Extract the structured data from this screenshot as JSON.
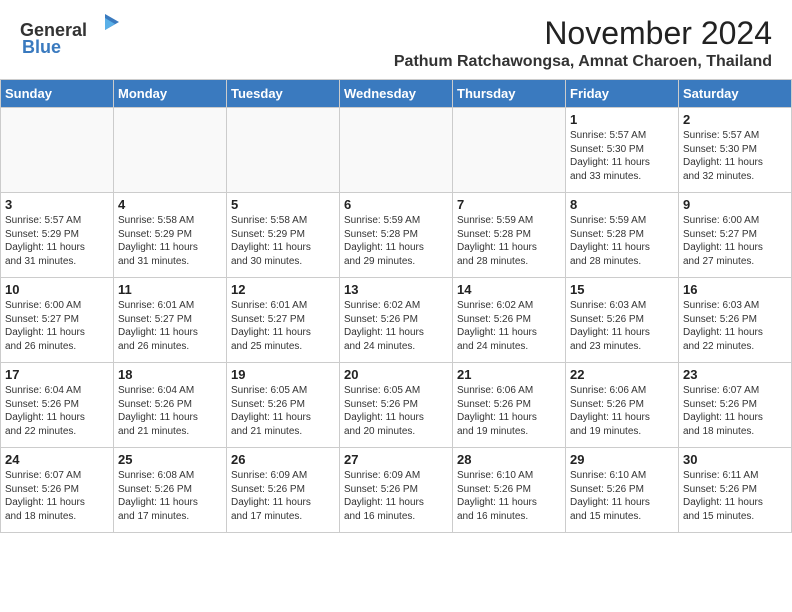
{
  "logo": {
    "general": "General",
    "blue": "Blue"
  },
  "title": "November 2024",
  "location": "Pathum Ratchawongsa, Amnat Charoen, Thailand",
  "weekdays": [
    "Sunday",
    "Monday",
    "Tuesday",
    "Wednesday",
    "Thursday",
    "Friday",
    "Saturday"
  ],
  "weeks": [
    [
      {
        "day": "",
        "info": ""
      },
      {
        "day": "",
        "info": ""
      },
      {
        "day": "",
        "info": ""
      },
      {
        "day": "",
        "info": ""
      },
      {
        "day": "",
        "info": ""
      },
      {
        "day": "1",
        "info": "Sunrise: 5:57 AM\nSunset: 5:30 PM\nDaylight: 11 hours\nand 33 minutes."
      },
      {
        "day": "2",
        "info": "Sunrise: 5:57 AM\nSunset: 5:30 PM\nDaylight: 11 hours\nand 32 minutes."
      }
    ],
    [
      {
        "day": "3",
        "info": "Sunrise: 5:57 AM\nSunset: 5:29 PM\nDaylight: 11 hours\nand 31 minutes."
      },
      {
        "day": "4",
        "info": "Sunrise: 5:58 AM\nSunset: 5:29 PM\nDaylight: 11 hours\nand 31 minutes."
      },
      {
        "day": "5",
        "info": "Sunrise: 5:58 AM\nSunset: 5:29 PM\nDaylight: 11 hours\nand 30 minutes."
      },
      {
        "day": "6",
        "info": "Sunrise: 5:59 AM\nSunset: 5:28 PM\nDaylight: 11 hours\nand 29 minutes."
      },
      {
        "day": "7",
        "info": "Sunrise: 5:59 AM\nSunset: 5:28 PM\nDaylight: 11 hours\nand 28 minutes."
      },
      {
        "day": "8",
        "info": "Sunrise: 5:59 AM\nSunset: 5:28 PM\nDaylight: 11 hours\nand 28 minutes."
      },
      {
        "day": "9",
        "info": "Sunrise: 6:00 AM\nSunset: 5:27 PM\nDaylight: 11 hours\nand 27 minutes."
      }
    ],
    [
      {
        "day": "10",
        "info": "Sunrise: 6:00 AM\nSunset: 5:27 PM\nDaylight: 11 hours\nand 26 minutes."
      },
      {
        "day": "11",
        "info": "Sunrise: 6:01 AM\nSunset: 5:27 PM\nDaylight: 11 hours\nand 26 minutes."
      },
      {
        "day": "12",
        "info": "Sunrise: 6:01 AM\nSunset: 5:27 PM\nDaylight: 11 hours\nand 25 minutes."
      },
      {
        "day": "13",
        "info": "Sunrise: 6:02 AM\nSunset: 5:26 PM\nDaylight: 11 hours\nand 24 minutes."
      },
      {
        "day": "14",
        "info": "Sunrise: 6:02 AM\nSunset: 5:26 PM\nDaylight: 11 hours\nand 24 minutes."
      },
      {
        "day": "15",
        "info": "Sunrise: 6:03 AM\nSunset: 5:26 PM\nDaylight: 11 hours\nand 23 minutes."
      },
      {
        "day": "16",
        "info": "Sunrise: 6:03 AM\nSunset: 5:26 PM\nDaylight: 11 hours\nand 22 minutes."
      }
    ],
    [
      {
        "day": "17",
        "info": "Sunrise: 6:04 AM\nSunset: 5:26 PM\nDaylight: 11 hours\nand 22 minutes."
      },
      {
        "day": "18",
        "info": "Sunrise: 6:04 AM\nSunset: 5:26 PM\nDaylight: 11 hours\nand 21 minutes."
      },
      {
        "day": "19",
        "info": "Sunrise: 6:05 AM\nSunset: 5:26 PM\nDaylight: 11 hours\nand 21 minutes."
      },
      {
        "day": "20",
        "info": "Sunrise: 6:05 AM\nSunset: 5:26 PM\nDaylight: 11 hours\nand 20 minutes."
      },
      {
        "day": "21",
        "info": "Sunrise: 6:06 AM\nSunset: 5:26 PM\nDaylight: 11 hours\nand 19 minutes."
      },
      {
        "day": "22",
        "info": "Sunrise: 6:06 AM\nSunset: 5:26 PM\nDaylight: 11 hours\nand 19 minutes."
      },
      {
        "day": "23",
        "info": "Sunrise: 6:07 AM\nSunset: 5:26 PM\nDaylight: 11 hours\nand 18 minutes."
      }
    ],
    [
      {
        "day": "24",
        "info": "Sunrise: 6:07 AM\nSunset: 5:26 PM\nDaylight: 11 hours\nand 18 minutes."
      },
      {
        "day": "25",
        "info": "Sunrise: 6:08 AM\nSunset: 5:26 PM\nDaylight: 11 hours\nand 17 minutes."
      },
      {
        "day": "26",
        "info": "Sunrise: 6:09 AM\nSunset: 5:26 PM\nDaylight: 11 hours\nand 17 minutes."
      },
      {
        "day": "27",
        "info": "Sunrise: 6:09 AM\nSunset: 5:26 PM\nDaylight: 11 hours\nand 16 minutes."
      },
      {
        "day": "28",
        "info": "Sunrise: 6:10 AM\nSunset: 5:26 PM\nDaylight: 11 hours\nand 16 minutes."
      },
      {
        "day": "29",
        "info": "Sunrise: 6:10 AM\nSunset: 5:26 PM\nDaylight: 11 hours\nand 15 minutes."
      },
      {
        "day": "30",
        "info": "Sunrise: 6:11 AM\nSunset: 5:26 PM\nDaylight: 11 hours\nand 15 minutes."
      }
    ]
  ]
}
